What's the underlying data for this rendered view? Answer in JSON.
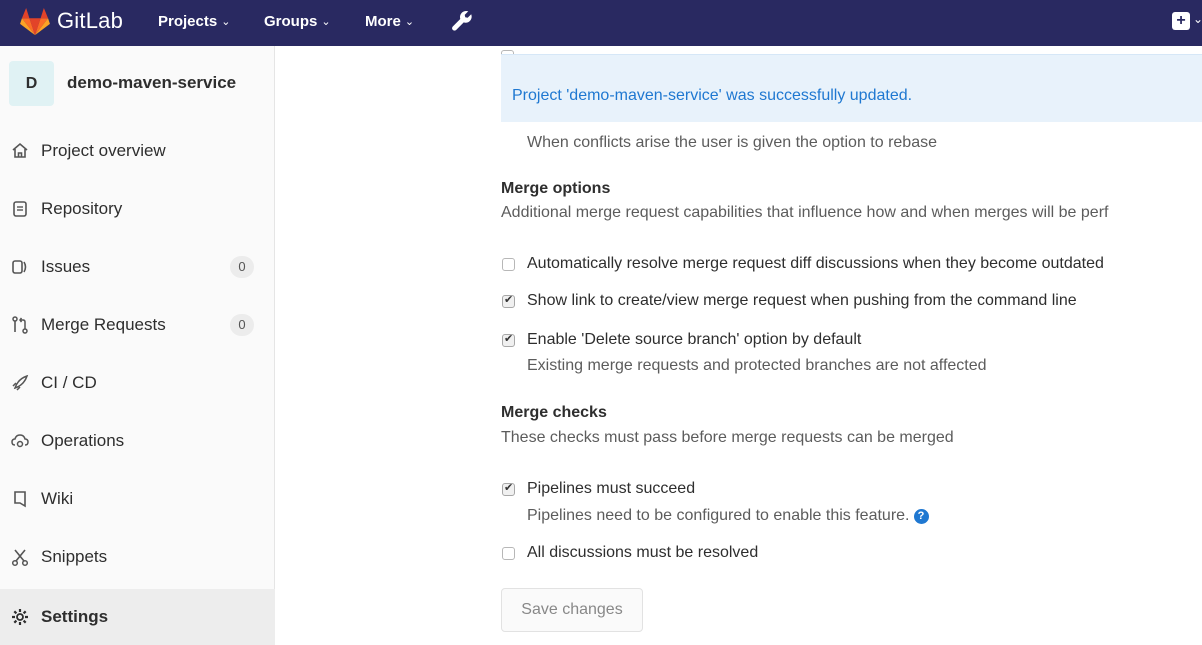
{
  "navbar": {
    "brand": "GitLab",
    "items": [
      {
        "label": "Projects"
      },
      {
        "label": "Groups"
      },
      {
        "label": "More"
      }
    ]
  },
  "sidebar": {
    "project_avatar_letter": "D",
    "project_name": "demo-maven-service",
    "items": [
      {
        "label": "Project overview",
        "icon": "home-icon"
      },
      {
        "label": "Repository",
        "icon": "file-icon"
      },
      {
        "label": "Issues",
        "icon": "issues-icon",
        "count": "0"
      },
      {
        "label": "Merge Requests",
        "icon": "merge-request-icon",
        "count": "0"
      },
      {
        "label": "CI / CD",
        "icon": "rocket-icon"
      },
      {
        "label": "Operations",
        "icon": "cloud-gear-icon"
      },
      {
        "label": "Wiki",
        "icon": "book-icon"
      },
      {
        "label": "Snippets",
        "icon": "scissors-icon"
      },
      {
        "label": "Settings",
        "icon": "gear-icon",
        "active": true
      }
    ]
  },
  "flash": {
    "message": "Project 'demo-maven-service' was successfully updated."
  },
  "content": {
    "rebase_help": "When conflicts arise the user is given the option to rebase",
    "merge_options": {
      "title": "Merge options",
      "description": "Additional merge request capabilities that influence how and when merges will be perf",
      "options": [
        {
          "label": "Automatically resolve merge request diff discussions when they become outdated",
          "checked": false
        },
        {
          "label": "Show link to create/view merge request when pushing from the command line",
          "checked": true
        },
        {
          "label": "Enable 'Delete source branch' option by default",
          "checked": true,
          "help": "Existing merge requests and protected branches are not affected"
        }
      ]
    },
    "merge_checks": {
      "title": "Merge checks",
      "description": "These checks must pass before merge requests can be merged",
      "options": [
        {
          "label": "Pipelines must succeed",
          "checked": true,
          "help": "Pipelines need to be configured to enable this feature."
        },
        {
          "label": "All discussions must be resolved",
          "checked": false
        }
      ]
    },
    "save_label": "Save changes"
  },
  "colors": {
    "navbar_bg": "#292961",
    "flash_bg": "#e8f2fb",
    "flash_text": "#1f78d1",
    "logo_orange": "#fc6d26"
  }
}
